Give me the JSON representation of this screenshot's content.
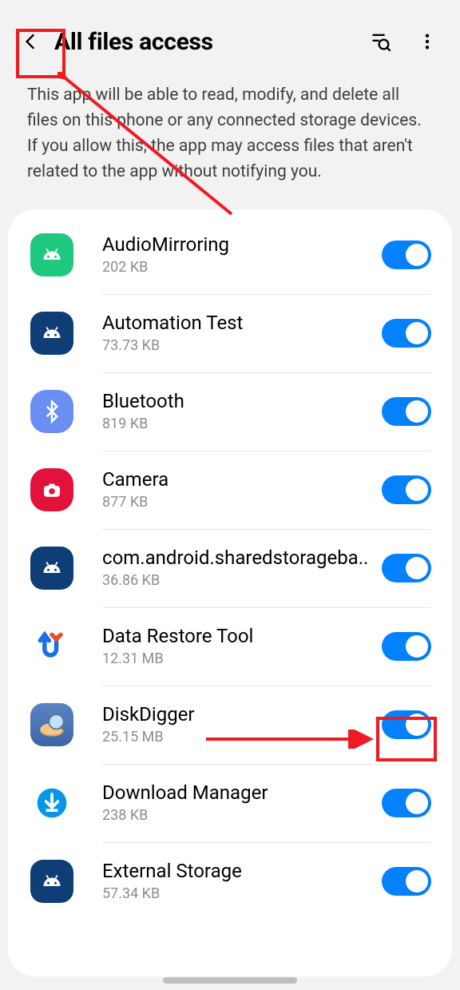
{
  "header": {
    "title": "All files access",
    "description": "This app will be able to read, modify, and delete all files on this phone or any connected storage devices. If you allow this, the app may access files that aren't related to the app without notifying you."
  },
  "apps": [
    {
      "name": "AudioMirroring",
      "size": "202 KB"
    },
    {
      "name": "Automation Test",
      "size": "73.73 KB"
    },
    {
      "name": "Bluetooth",
      "size": "819 KB"
    },
    {
      "name": "Camera",
      "size": "877 KB"
    },
    {
      "name": "com.android.sharedstorageba..",
      "size": "36.86 KB"
    },
    {
      "name": "Data Restore Tool",
      "size": "12.31 MB"
    },
    {
      "name": "DiskDigger",
      "size": "25.15 MB"
    },
    {
      "name": "Download Manager",
      "size": "238 KB"
    },
    {
      "name": "External Storage",
      "size": "57.34 KB"
    }
  ],
  "annotations": {
    "highlight_back": true,
    "highlight_toggle_index": 6,
    "colors": {
      "highlight": "#ee1b22",
      "accent": "#0381fe"
    }
  }
}
